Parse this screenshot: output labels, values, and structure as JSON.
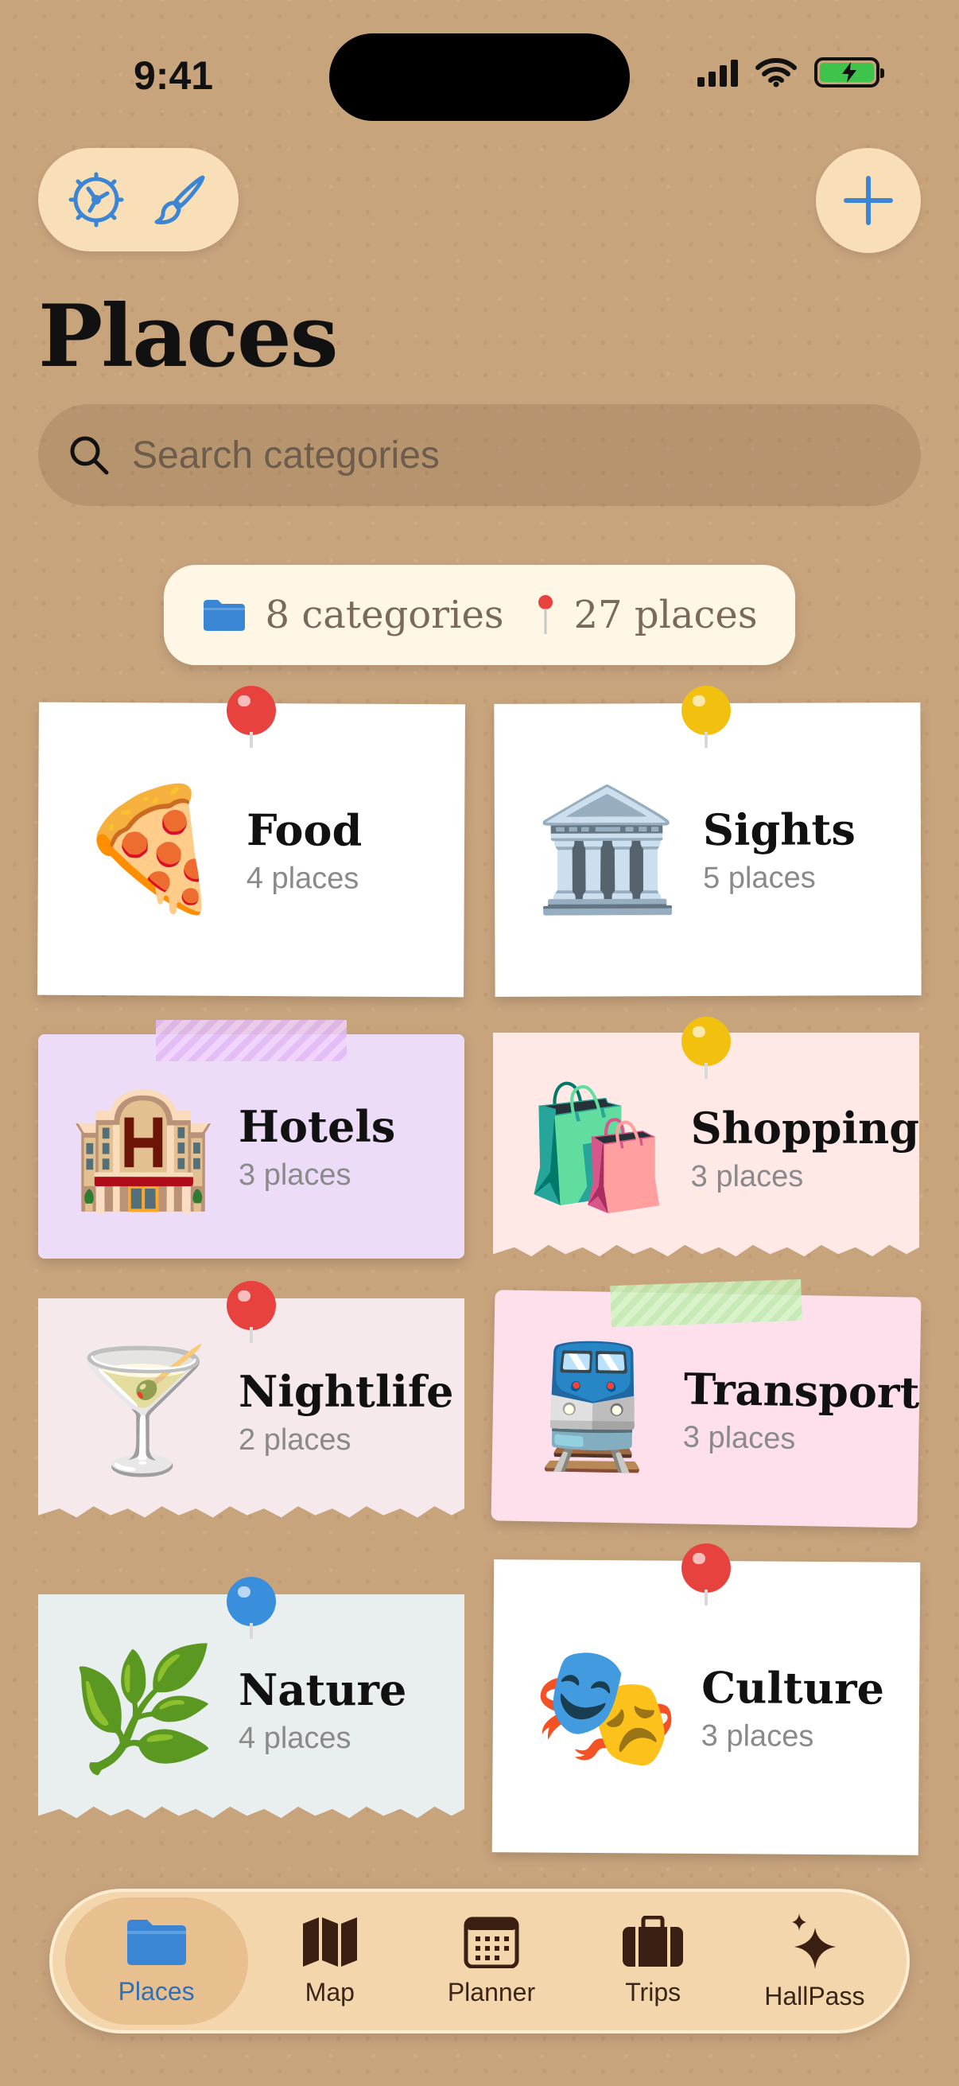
{
  "status": {
    "time": "9:41"
  },
  "toolbar": {
    "settings_icon": "settings-dial-icon",
    "theme_icon": "paintbrush-icon",
    "add_icon": "plus-icon"
  },
  "page": {
    "title": "Places"
  },
  "search": {
    "placeholder": "Search categories",
    "value": ""
  },
  "summary": {
    "categories": "8 categories",
    "places": "27 places"
  },
  "categories": [
    {
      "name": "Food",
      "count": "4 places",
      "emoji": "🍕"
    },
    {
      "name": "Sights",
      "count": "5 places",
      "emoji": "🏛️"
    },
    {
      "name": "Hotels",
      "count": "3 places",
      "emoji": "🏨"
    },
    {
      "name": "Shopping",
      "count": "3 places",
      "emoji": "🛍️"
    },
    {
      "name": "Nightlife",
      "count": "2 places",
      "emoji": "🍸"
    },
    {
      "name": "Transport",
      "count": "3 places",
      "emoji": "🚆"
    },
    {
      "name": "Nature",
      "count": "4 places",
      "emoji": "🌿"
    },
    {
      "name": "Culture",
      "count": "3 places",
      "emoji": "🎭"
    }
  ],
  "tabs": [
    {
      "label": "Places",
      "icon": "folder-icon",
      "active": true
    },
    {
      "label": "Map",
      "icon": "map-icon",
      "active": false
    },
    {
      "label": "Planner",
      "icon": "calendar-icon",
      "active": false
    },
    {
      "label": "Trips",
      "icon": "suitcase-icon",
      "active": false
    },
    {
      "label": "HallPass",
      "icon": "sparkles-icon",
      "active": false
    }
  ],
  "colors": {
    "background": "#c8a47d",
    "accent": "#3a86d4",
    "pin_red": "#e8423f",
    "pin_yellow": "#f2c10f",
    "pin_blue": "#3a8fdc"
  }
}
